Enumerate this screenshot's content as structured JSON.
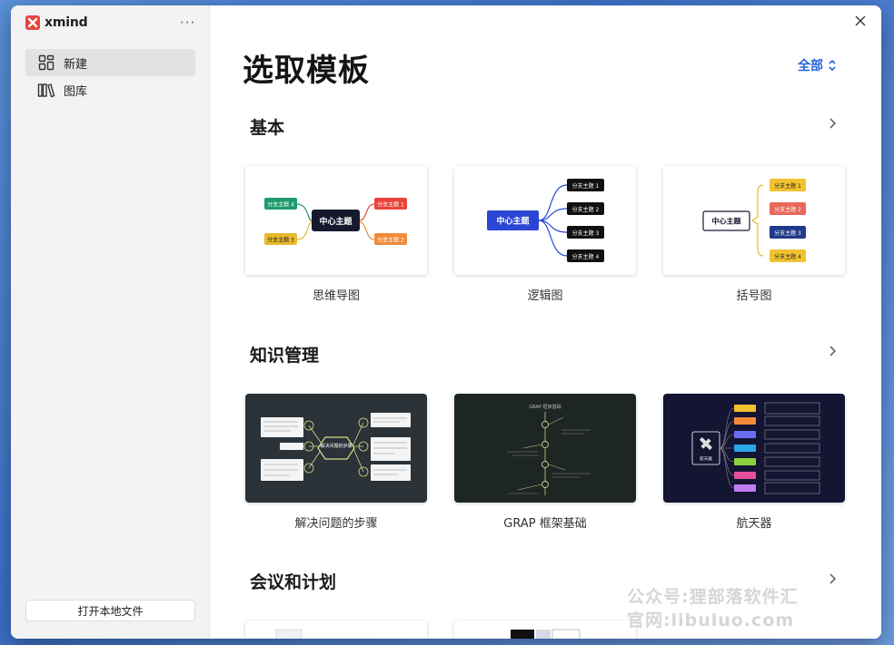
{
  "app": {
    "name": "xmind",
    "more_label": "···"
  },
  "sidebar": {
    "items": [
      {
        "label": "新建",
        "icon": "grid-icon",
        "active": true
      },
      {
        "label": "图库",
        "icon": "library-icon",
        "active": false
      }
    ],
    "open_local_label": "打开本地文件"
  },
  "main": {
    "title": "选取模板",
    "filter_label": "全部",
    "sections": [
      {
        "title": "基本",
        "cards": [
          {
            "label": "思维导图",
            "center": "中心主题",
            "branches": [
              "分支主题 4",
              "分支主题 1",
              "分支主题 3",
              "分支主题 2"
            ]
          },
          {
            "label": "逻辑图",
            "center": "中心主题",
            "branches": [
              "分支主题 1",
              "分支主题 2",
              "分支主题 3",
              "分支主题 4"
            ]
          },
          {
            "label": "括号图",
            "center": "中心主题",
            "branches": [
              "分支主题 1",
              "分支主题 2",
              "分支主题 3",
              "分支主题 4"
            ]
          }
        ]
      },
      {
        "title": "知识管理",
        "cards": [
          {
            "label": "解决问题的步骤",
            "center": "解决问题的步骤"
          },
          {
            "label": "GRAP 框架基础",
            "header": "GRAP 框架基础"
          },
          {
            "label": "航天器",
            "center": "航天器"
          }
        ]
      },
      {
        "title": "会议和计划",
        "cards": []
      }
    ]
  },
  "watermark": {
    "line1": "公众号:狸部落软件汇",
    "line2": "官网:libuluo.com"
  },
  "colors": {
    "accent": "#2563d8",
    "brand": "#e8453c",
    "sidebar_bg": "#f3f3f3"
  }
}
